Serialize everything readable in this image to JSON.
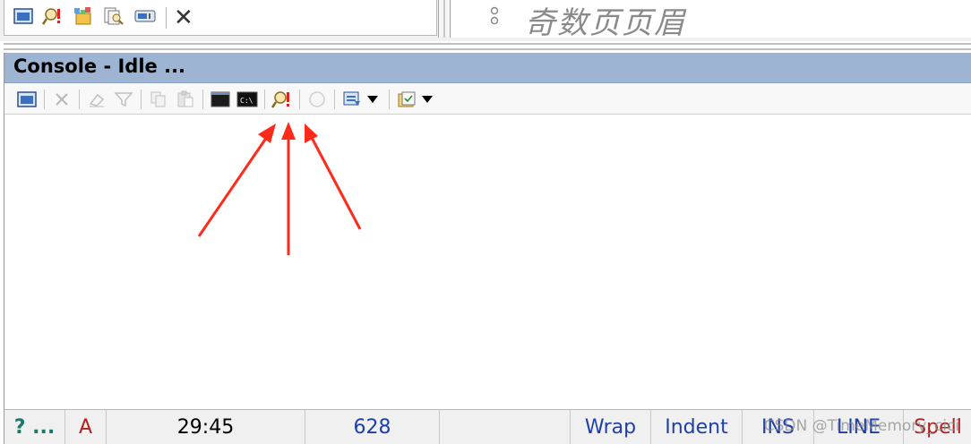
{
  "top": {
    "header_mark": "ﾟ",
    "header_text": "奇数页页眉",
    "close_glyph": "✕"
  },
  "console": {
    "title": "Console - Idle ..."
  },
  "status": {
    "help": "? ...",
    "font_flag": "A",
    "position": "29:45",
    "count": "628",
    "wrap": "Wrap",
    "indent": "Indent",
    "ins": "INS",
    "line": "LINE",
    "spell": "Spell"
  },
  "watermark": "CSDN @TimeMemory_cici",
  "colors": {
    "title_bar": "#9db4d2",
    "status_blue": "#1f3fa8",
    "status_green": "#1a7a6a",
    "status_red": "#b02020",
    "arrow": "#ff2a1a"
  }
}
